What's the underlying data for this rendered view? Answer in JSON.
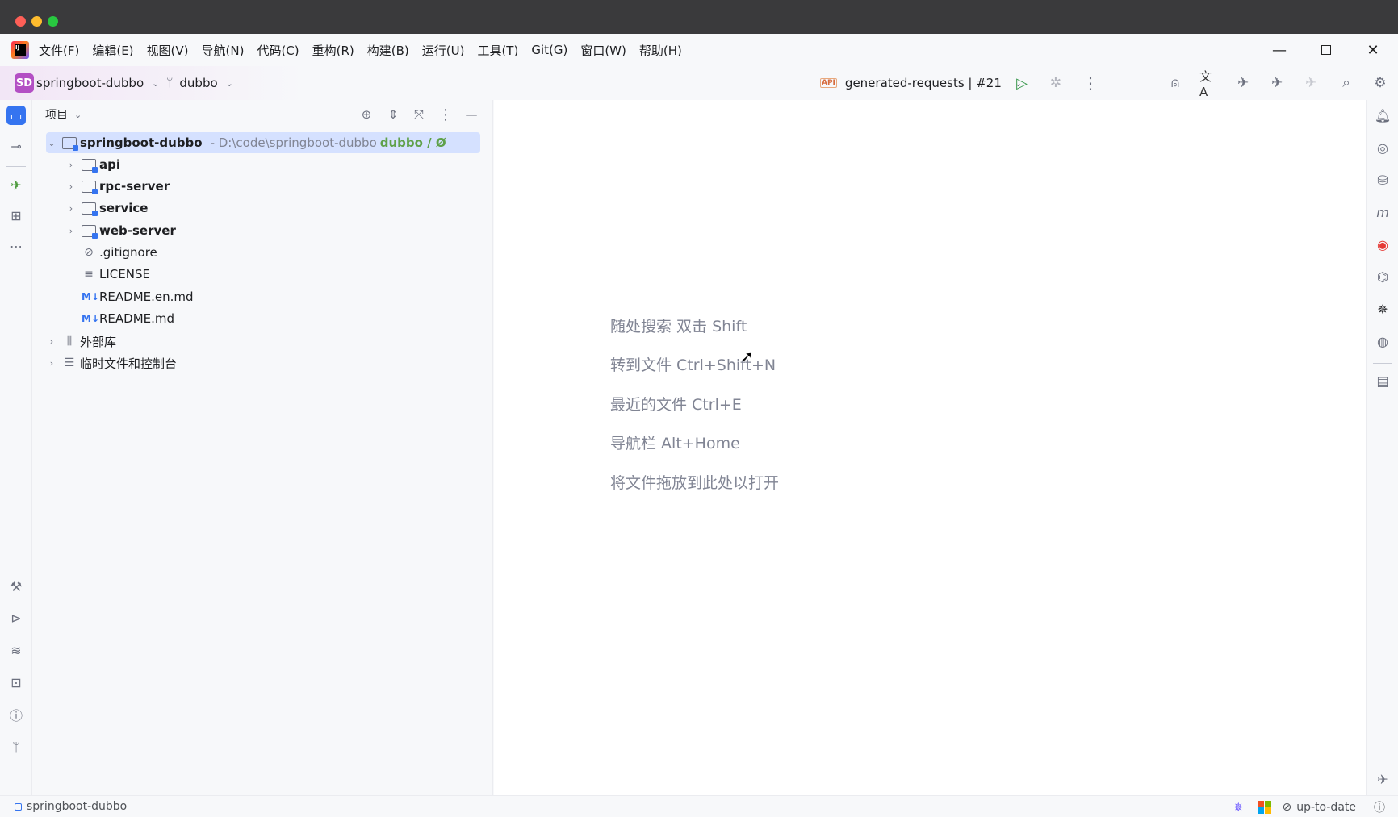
{
  "menubar": {
    "items": [
      "文件(F)",
      "编辑(E)",
      "视图(V)",
      "导航(N)",
      "代码(C)",
      "重构(R)",
      "构建(B)",
      "运行(U)",
      "工具(T)",
      "Git(G)",
      "窗口(W)",
      "帮助(H)"
    ],
    "app_logo": "IJ"
  },
  "toolbar": {
    "project_badge": "SD",
    "project_name": "springboot-dubbo",
    "branch": "dubbo",
    "run_config": "generated-requests | #21",
    "run_config_icon": "API"
  },
  "panel": {
    "title": "项目",
    "root": {
      "name": "springboot-dubbo",
      "path": "- D:\\code\\springboot-dubbo",
      "vcs": "dubbo / Ø"
    },
    "modules": [
      "api",
      "rpc-server",
      "service",
      "web-server"
    ],
    "files": [
      ".gitignore",
      "LICENSE",
      "README.en.md",
      "README.md"
    ],
    "md_icon": "M↓",
    "external_libs": "外部库",
    "scratches": "临时文件和控制台"
  },
  "editor": {
    "hints": [
      "随处搜索 双击 Shift",
      "转到文件 Ctrl+Shift+N",
      "最近的文件 Ctrl+E",
      "导航栏 Alt+Home",
      "将文件拖放到此处以打开"
    ]
  },
  "statusbar": {
    "project": "springboot-dubbo",
    "status": "up-to-date"
  }
}
